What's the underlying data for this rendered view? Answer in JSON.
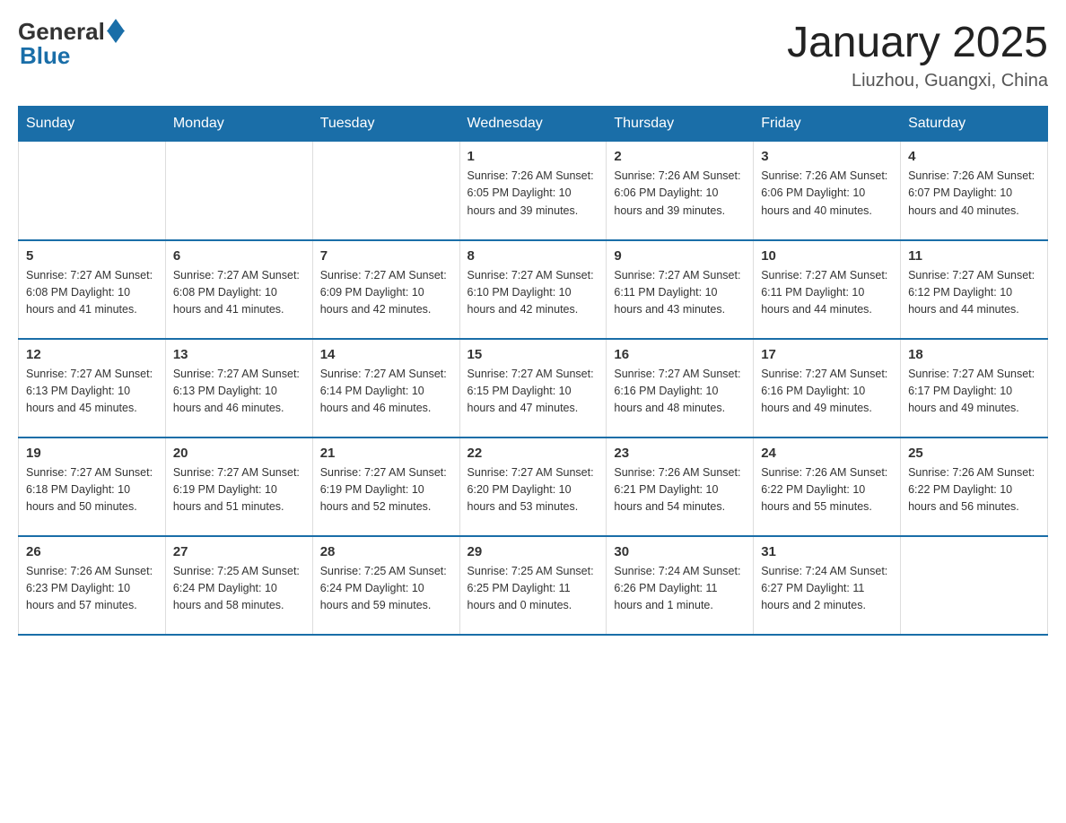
{
  "header": {
    "logo_general": "General",
    "logo_blue": "Blue",
    "title": "January 2025",
    "subtitle": "Liuzhou, Guangxi, China"
  },
  "days_of_week": [
    "Sunday",
    "Monday",
    "Tuesday",
    "Wednesday",
    "Thursday",
    "Friday",
    "Saturday"
  ],
  "weeks": [
    [
      {
        "num": "",
        "info": ""
      },
      {
        "num": "",
        "info": ""
      },
      {
        "num": "",
        "info": ""
      },
      {
        "num": "1",
        "info": "Sunrise: 7:26 AM\nSunset: 6:05 PM\nDaylight: 10 hours\nand 39 minutes."
      },
      {
        "num": "2",
        "info": "Sunrise: 7:26 AM\nSunset: 6:06 PM\nDaylight: 10 hours\nand 39 minutes."
      },
      {
        "num": "3",
        "info": "Sunrise: 7:26 AM\nSunset: 6:06 PM\nDaylight: 10 hours\nand 40 minutes."
      },
      {
        "num": "4",
        "info": "Sunrise: 7:26 AM\nSunset: 6:07 PM\nDaylight: 10 hours\nand 40 minutes."
      }
    ],
    [
      {
        "num": "5",
        "info": "Sunrise: 7:27 AM\nSunset: 6:08 PM\nDaylight: 10 hours\nand 41 minutes."
      },
      {
        "num": "6",
        "info": "Sunrise: 7:27 AM\nSunset: 6:08 PM\nDaylight: 10 hours\nand 41 minutes."
      },
      {
        "num": "7",
        "info": "Sunrise: 7:27 AM\nSunset: 6:09 PM\nDaylight: 10 hours\nand 42 minutes."
      },
      {
        "num": "8",
        "info": "Sunrise: 7:27 AM\nSunset: 6:10 PM\nDaylight: 10 hours\nand 42 minutes."
      },
      {
        "num": "9",
        "info": "Sunrise: 7:27 AM\nSunset: 6:11 PM\nDaylight: 10 hours\nand 43 minutes."
      },
      {
        "num": "10",
        "info": "Sunrise: 7:27 AM\nSunset: 6:11 PM\nDaylight: 10 hours\nand 44 minutes."
      },
      {
        "num": "11",
        "info": "Sunrise: 7:27 AM\nSunset: 6:12 PM\nDaylight: 10 hours\nand 44 minutes."
      }
    ],
    [
      {
        "num": "12",
        "info": "Sunrise: 7:27 AM\nSunset: 6:13 PM\nDaylight: 10 hours\nand 45 minutes."
      },
      {
        "num": "13",
        "info": "Sunrise: 7:27 AM\nSunset: 6:13 PM\nDaylight: 10 hours\nand 46 minutes."
      },
      {
        "num": "14",
        "info": "Sunrise: 7:27 AM\nSunset: 6:14 PM\nDaylight: 10 hours\nand 46 minutes."
      },
      {
        "num": "15",
        "info": "Sunrise: 7:27 AM\nSunset: 6:15 PM\nDaylight: 10 hours\nand 47 minutes."
      },
      {
        "num": "16",
        "info": "Sunrise: 7:27 AM\nSunset: 6:16 PM\nDaylight: 10 hours\nand 48 minutes."
      },
      {
        "num": "17",
        "info": "Sunrise: 7:27 AM\nSunset: 6:16 PM\nDaylight: 10 hours\nand 49 minutes."
      },
      {
        "num": "18",
        "info": "Sunrise: 7:27 AM\nSunset: 6:17 PM\nDaylight: 10 hours\nand 49 minutes."
      }
    ],
    [
      {
        "num": "19",
        "info": "Sunrise: 7:27 AM\nSunset: 6:18 PM\nDaylight: 10 hours\nand 50 minutes."
      },
      {
        "num": "20",
        "info": "Sunrise: 7:27 AM\nSunset: 6:19 PM\nDaylight: 10 hours\nand 51 minutes."
      },
      {
        "num": "21",
        "info": "Sunrise: 7:27 AM\nSunset: 6:19 PM\nDaylight: 10 hours\nand 52 minutes."
      },
      {
        "num": "22",
        "info": "Sunrise: 7:27 AM\nSunset: 6:20 PM\nDaylight: 10 hours\nand 53 minutes."
      },
      {
        "num": "23",
        "info": "Sunrise: 7:26 AM\nSunset: 6:21 PM\nDaylight: 10 hours\nand 54 minutes."
      },
      {
        "num": "24",
        "info": "Sunrise: 7:26 AM\nSunset: 6:22 PM\nDaylight: 10 hours\nand 55 minutes."
      },
      {
        "num": "25",
        "info": "Sunrise: 7:26 AM\nSunset: 6:22 PM\nDaylight: 10 hours\nand 56 minutes."
      }
    ],
    [
      {
        "num": "26",
        "info": "Sunrise: 7:26 AM\nSunset: 6:23 PM\nDaylight: 10 hours\nand 57 minutes."
      },
      {
        "num": "27",
        "info": "Sunrise: 7:25 AM\nSunset: 6:24 PM\nDaylight: 10 hours\nand 58 minutes."
      },
      {
        "num": "28",
        "info": "Sunrise: 7:25 AM\nSunset: 6:24 PM\nDaylight: 10 hours\nand 59 minutes."
      },
      {
        "num": "29",
        "info": "Sunrise: 7:25 AM\nSunset: 6:25 PM\nDaylight: 11 hours\nand 0 minutes."
      },
      {
        "num": "30",
        "info": "Sunrise: 7:24 AM\nSunset: 6:26 PM\nDaylight: 11 hours\nand 1 minute."
      },
      {
        "num": "31",
        "info": "Sunrise: 7:24 AM\nSunset: 6:27 PM\nDaylight: 11 hours\nand 2 minutes."
      },
      {
        "num": "",
        "info": ""
      }
    ]
  ]
}
